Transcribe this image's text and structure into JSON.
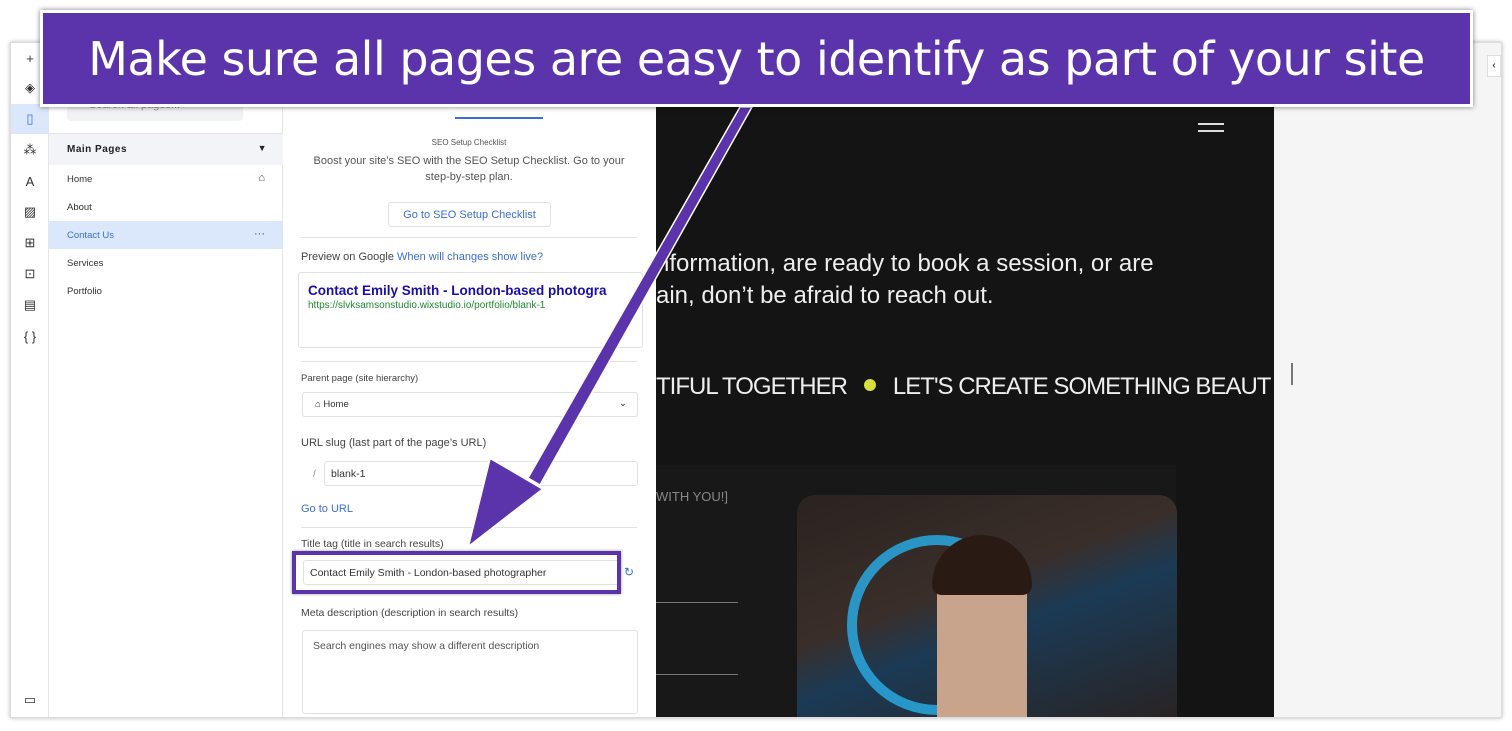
{
  "banner": {
    "text": "Make sure all pages are easy to identify as part of your site",
    "color": "#5b33ab"
  },
  "rail": {
    "icons": [
      "plus-icon",
      "layers-icon",
      "pages-icon",
      "connections-icon",
      "text-theme-icon",
      "media-icon",
      "apps-icon",
      "components-icon",
      "table-icon",
      "code-icon",
      "chat-icon"
    ]
  },
  "pages_panel": {
    "search_placeholder": "Search all pages...",
    "group_label": "Main Pages",
    "items": [
      {
        "label": "Home"
      },
      {
        "label": "About"
      },
      {
        "label": "Contact Us"
      },
      {
        "label": "Services"
      },
      {
        "label": "Portfolio"
      }
    ],
    "selected": "Contact Us"
  },
  "seo": {
    "checklist_title": "SEO Setup Checklist",
    "checklist_text": "Boost your site’s SEO with the SEO Setup Checklist. Go to your step-by-step plan.",
    "checklist_button": "Go to SEO Setup Checklist",
    "preview_label": "Preview on Google",
    "preview_link": "When will changes show live?",
    "preview_title": "Contact Emily Smith - London-based photogra",
    "preview_url": "https://slvksamsonstudio.wixstudio.io/portfolio/blank-1",
    "parent_label": "Parent page (site hierarchy)",
    "parent_value": "Home",
    "slug_label": "URL slug (last part of the page’s URL)",
    "slug_prefix": "/",
    "slug_value": "blank-1",
    "go_to_url": "Go to URL",
    "title_label": "Title tag (title in search results)",
    "title_value": "Contact Emily Smith - London-based photographer",
    "meta_label": "Meta description (description in search results)",
    "meta_placeholder": "Search engines may show a different description"
  },
  "canvas": {
    "line1": "nformation, are ready to book a session, or are",
    "line2": "ain, don’t be afraid to reach out.",
    "marquee_a": "TIFUL TOGETHER",
    "marquee_b": "LET'S CREATE SOMETHING BEAUT",
    "side_label": "WITH YOU!]",
    "dot_color": "#d6e03a"
  }
}
